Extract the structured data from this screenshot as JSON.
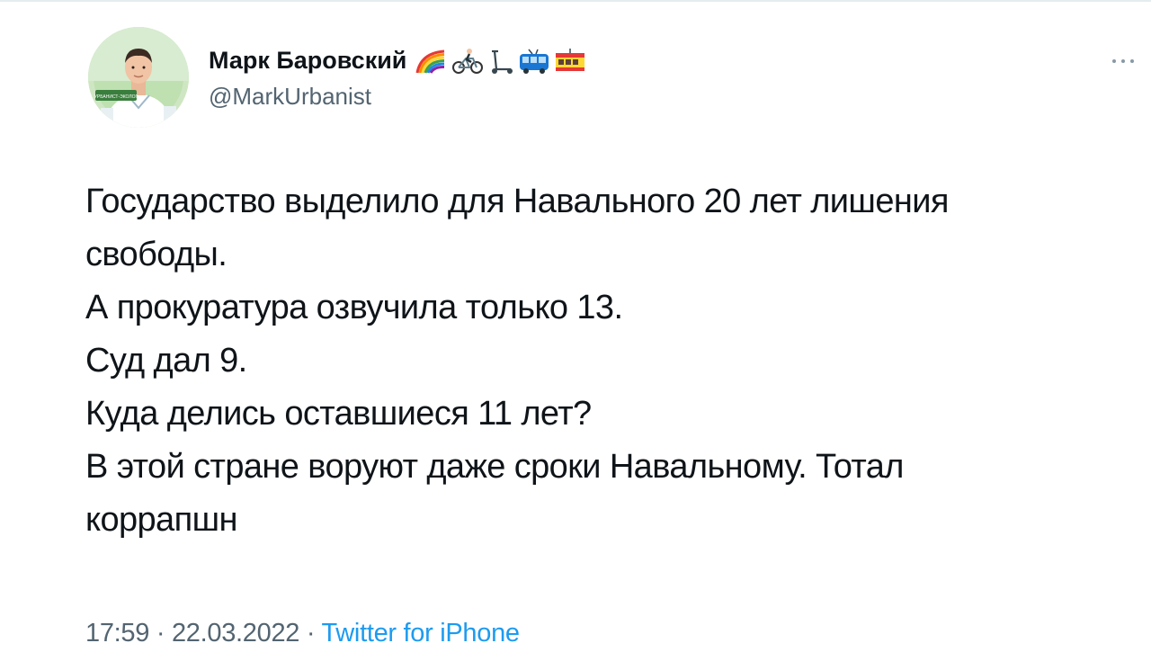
{
  "tweet": {
    "author": {
      "display_name": "Марк Баровский",
      "name_emojis": [
        "rainbow-icon",
        "cyclist-icon",
        "scooter-icon",
        "bus-icon",
        "tram-icon"
      ],
      "handle": "@MarkUrbanist",
      "avatar_badge_text": "УРБАНИСТ-ЭКОЛОГ"
    },
    "body_lines": [
      "Государство выделило для Навального 20 лет лишения",
      "свободы.",
      "А прокуратура озвучила только 13.",
      "Суд дал 9.",
      "Куда делись оставшиеся 11 лет?",
      "В этой стране воруют даже сроки Навальному. Тотал",
      "коррапшн"
    ],
    "meta": {
      "time": "17:59",
      "separator": " · ",
      "date": "22.03.2022",
      "source": "Twitter for iPhone"
    }
  },
  "colors": {
    "text_primary": "#0f1419",
    "text_secondary": "#536471",
    "link": "#1d9bf0",
    "avatar_bg": "#d9ecd0"
  }
}
